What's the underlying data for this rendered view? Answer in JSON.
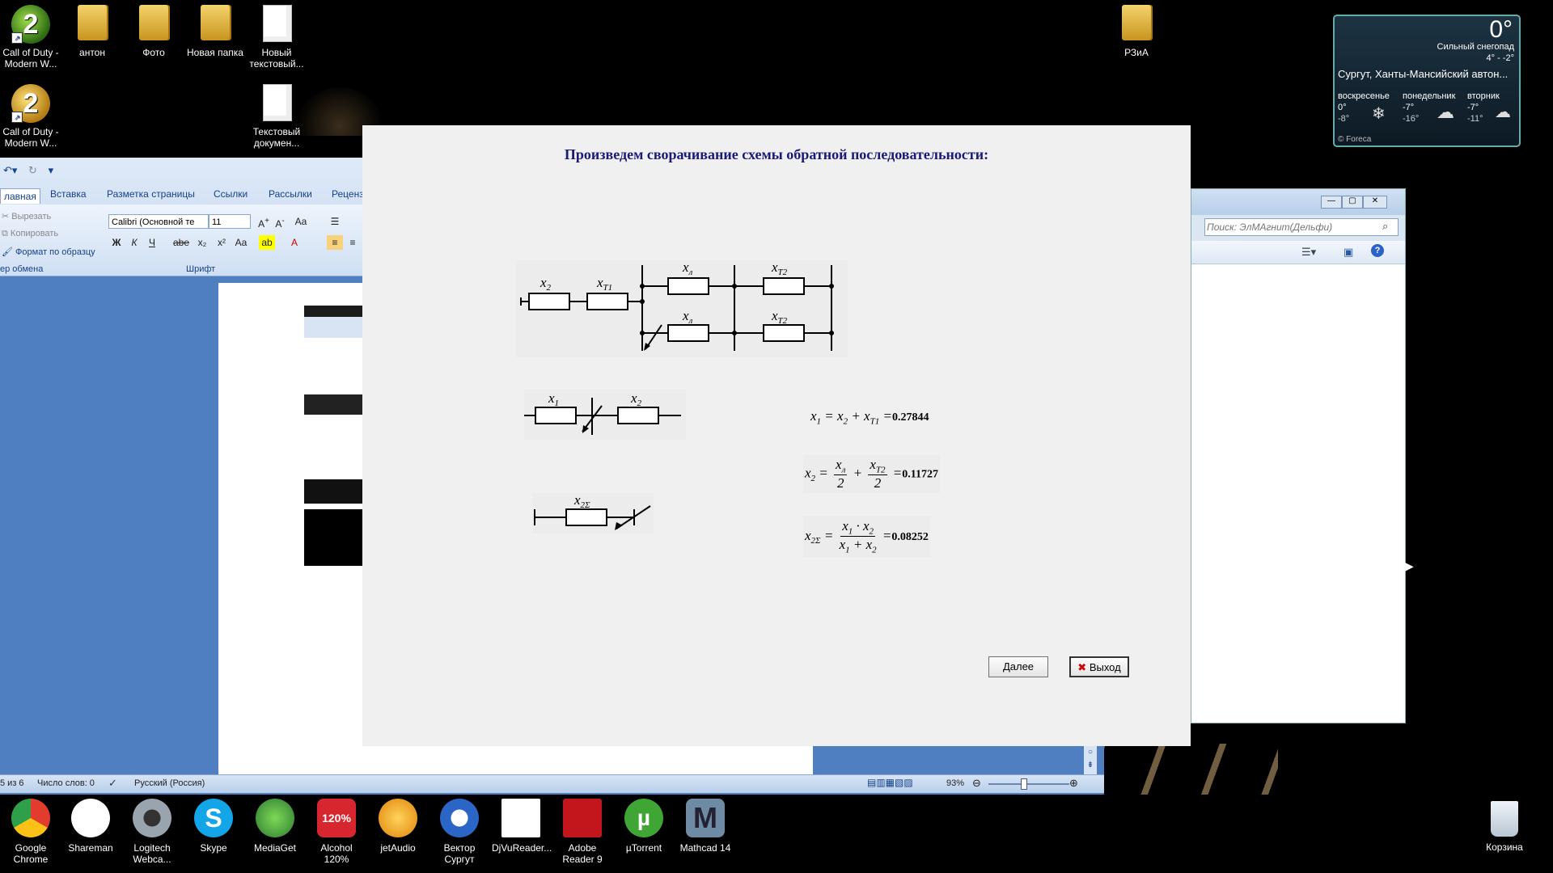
{
  "desktop_icons": [
    {
      "label": "Call of Duty - Modern W...",
      "icon": "cod-icon"
    },
    {
      "label": "антон",
      "icon": "folder-icon"
    },
    {
      "label": "Фото",
      "icon": "folder-icon"
    },
    {
      "label": "Новая папка",
      "icon": "folder-icon"
    },
    {
      "label": "Новый текстовый...",
      "icon": "text-file-icon"
    },
    {
      "label": "Call of Duty - Modern W...",
      "icon": "cod-icon"
    },
    {
      "label": "Текстовый докумен...",
      "icon": "text-file-icon"
    },
    {
      "label": "РЗиА",
      "icon": "folder-icon"
    }
  ],
  "weather": {
    "temp": "0°",
    "condition": "Сильный снегопад",
    "range": "4° - -2°",
    "location": "Сургут, Ханты-Мансийский автон...",
    "days": [
      {
        "name": "воскресенье",
        "hi": "0°",
        "lo": "-8°"
      },
      {
        "name": "понедельник",
        "hi": "-7°",
        "lo": "-16°"
      },
      {
        "name": "вторник",
        "hi": "-7°",
        "lo": "-11°"
      }
    ],
    "provider": "© Foreca"
  },
  "word": {
    "tabs": [
      "лавная",
      "Вставка",
      "Разметка страницы",
      "Ссылки",
      "Рассылки",
      "Реценз"
    ],
    "clipboard": {
      "cut": "Вырезать",
      "copy": "Копировать",
      "format": "Формат по образцу",
      "group": "ер обмена"
    },
    "font_name": "Calibri (Основной те",
    "font_size": "11",
    "font_group": "Шрифт",
    "status": {
      "page": "5 из 6",
      "words": "Число слов: 0",
      "lang": "Русский (Россия)",
      "zoom": "93%"
    }
  },
  "explorer": {
    "search_placeholder": "Поиск: ЭлМАгнит(Дельфи)"
  },
  "dialog": {
    "title": "Произведем сворачивание схемы обратной последовательности:",
    "next_button": "Далее",
    "exit_button": "Выход",
    "results": {
      "x1": "0.27844",
      "x2": "0.11727",
      "x2sum": "0.08252"
    }
  },
  "taskbar": [
    {
      "label": "Google Chrome",
      "icon": "chrome-icon",
      "color": "#e33b2e"
    },
    {
      "label": "Shareman",
      "icon": "shareman-icon",
      "color": "#ffffff"
    },
    {
      "label": "Logitech Webca...",
      "icon": "webcam-icon",
      "color": "#9aa4ae"
    },
    {
      "label": "Skype",
      "icon": "skype-icon",
      "color": "#12a5e8"
    },
    {
      "label": "MediaGet",
      "icon": "mediaget-icon",
      "color": "#3aa343"
    },
    {
      "label": "Alcohol 120%",
      "icon": "alcohol-icon",
      "color": "#d8262e"
    },
    {
      "label": "jetAudio",
      "icon": "jetaudio-icon",
      "color": "#f2a21d"
    },
    {
      "label": "Вектор Сургут",
      "icon": "vector-icon",
      "color": "#2b66c7"
    },
    {
      "label": "DjVuReader...",
      "icon": "djvu-icon",
      "color": "#ffffff"
    },
    {
      "label": "Adobe Reader 9",
      "icon": "adobe-icon",
      "color": "#c2161c"
    },
    {
      "label": "µTorrent",
      "icon": "utorrent-icon",
      "color": "#3fa535"
    },
    {
      "label": "Mathcad 14",
      "icon": "mathcad-icon",
      "color": "#6f8aa3"
    }
  ],
  "recycle_bin": {
    "label": "Корзина"
  }
}
